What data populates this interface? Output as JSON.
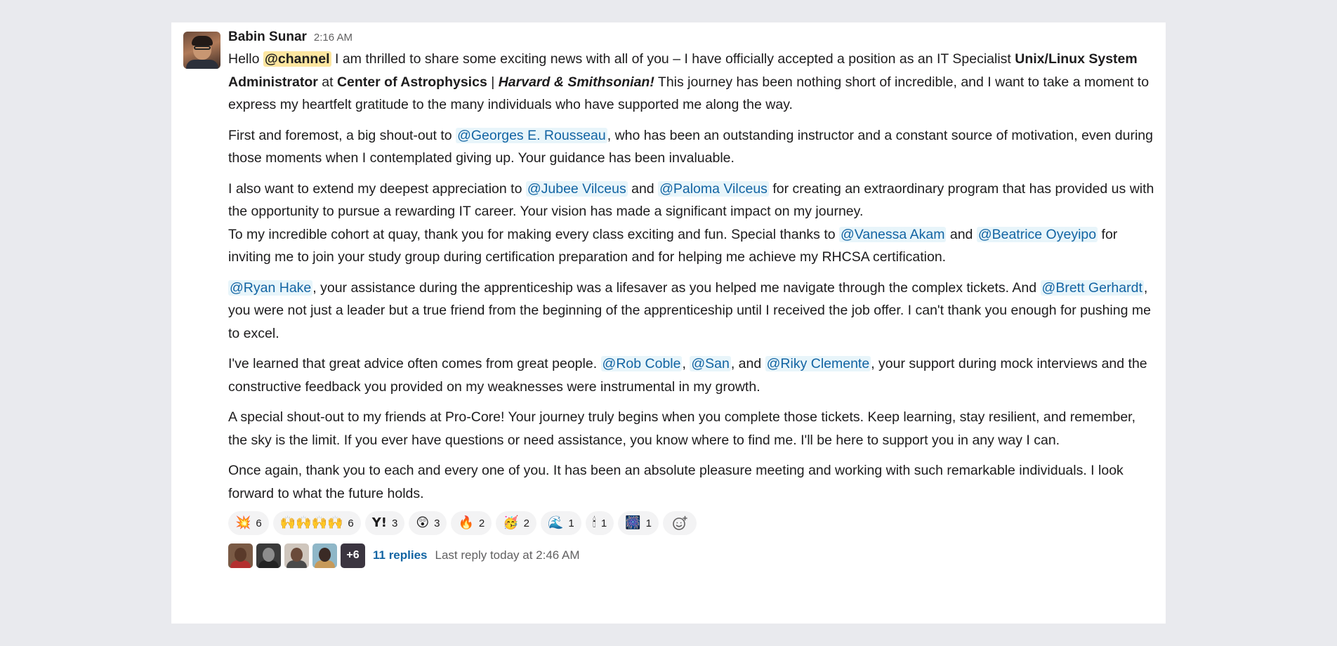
{
  "message": {
    "author": "Babin Sunar",
    "time": "2:16 AM",
    "p1": {
      "t1": "Hello ",
      "channel": "@channel",
      "t2": " I am thrilled to share some exciting news with all of you – I have officially accepted a position as an IT Specialist ",
      "b1": "Unix/Linux System Administrator",
      "t3": " at ",
      "b2": "Center of Astrophysics",
      "t4": " | ",
      "bi": "Harvard & Smithsonian!",
      "t5": " This journey has been nothing short of incredible, and I want to take a moment to express my heartfelt gratitude to the many individuals who have supported me along the way."
    },
    "p2": {
      "t1": "First and foremost, a big shout-out to ",
      "m1": "@Georges E. Rousseau",
      "t2": ", who has been an outstanding instructor and a constant source of motivation, even during those moments when I contemplated giving up. Your guidance has been invaluable."
    },
    "p3": {
      "t1": "I also want to extend my deepest appreciation to ",
      "m1": "@Jubee Vilceus",
      "t2": " and ",
      "m2": "@Paloma Vilceus",
      "t3": " for creating an extraordinary program that has provided us with the opportunity to pursue a rewarding IT career. Your vision has made a significant impact on my journey."
    },
    "p4": {
      "t1": "To my incredible cohort at quay, thank you for making every class exciting and fun. Special thanks to ",
      "m1": "@Vanessa Akam",
      "t2": " and ",
      "m2": "@Beatrice Oyeyipo",
      "t3": " for inviting me to join your study group during certification preparation and for helping me achieve my RHCSA certification."
    },
    "p5": {
      "m1": "@Ryan Hake",
      "t1": ", your assistance during the apprenticeship was a lifesaver as you helped me navigate through the complex tickets. And ",
      "m2": "@Brett Gerhardt",
      "t2": ", you were not just a leader but a true friend from the beginning of the apprenticeship until I received the job offer. I can't thank you enough for pushing me to excel."
    },
    "p6": {
      "t1": "I've learned that great advice often comes from great people. ",
      "m1": "@Rob Coble",
      "t2": ", ",
      "m2": "@San",
      "t3": ", and ",
      "m3": "@Riky Clemente",
      "t4": ", your support during mock interviews and the constructive feedback you provided on my weaknesses were instrumental in my growth."
    },
    "p7": "A special shout-out to my friends at Pro-Core! Your journey truly begins when you complete those tickets. Keep learning, stay resilient, and remember, the sky is the limit. If you ever have questions or need assistance, you know where to find me. I'll be here to support you in any way I can.",
    "p8": "Once again, thank you to each and every one of you. It has been an absolute pleasure meeting and working with such remarkable individuals. I look forward to what the future holds."
  },
  "reactions": [
    {
      "emoji": "💥",
      "count": "6"
    },
    {
      "emoji": "🙌🙌🙌🙌",
      "count": "6"
    },
    {
      "emoji": "Y!",
      "count": "3"
    },
    {
      "emoji": "😲",
      "count": "3"
    },
    {
      "emoji": "🔥",
      "count": "2"
    },
    {
      "emoji": "🥳",
      "count": "2"
    },
    {
      "emoji": "🌊",
      "count": "1"
    },
    {
      "emoji": "🕯",
      "count": "1"
    },
    {
      "emoji": "🎆",
      "count": "1"
    }
  ],
  "add_reaction_icon": "add-emoji-icon",
  "thread": {
    "more_count": "+6",
    "replies": "11 replies",
    "last_reply": "Last reply today at 2:46 AM"
  }
}
